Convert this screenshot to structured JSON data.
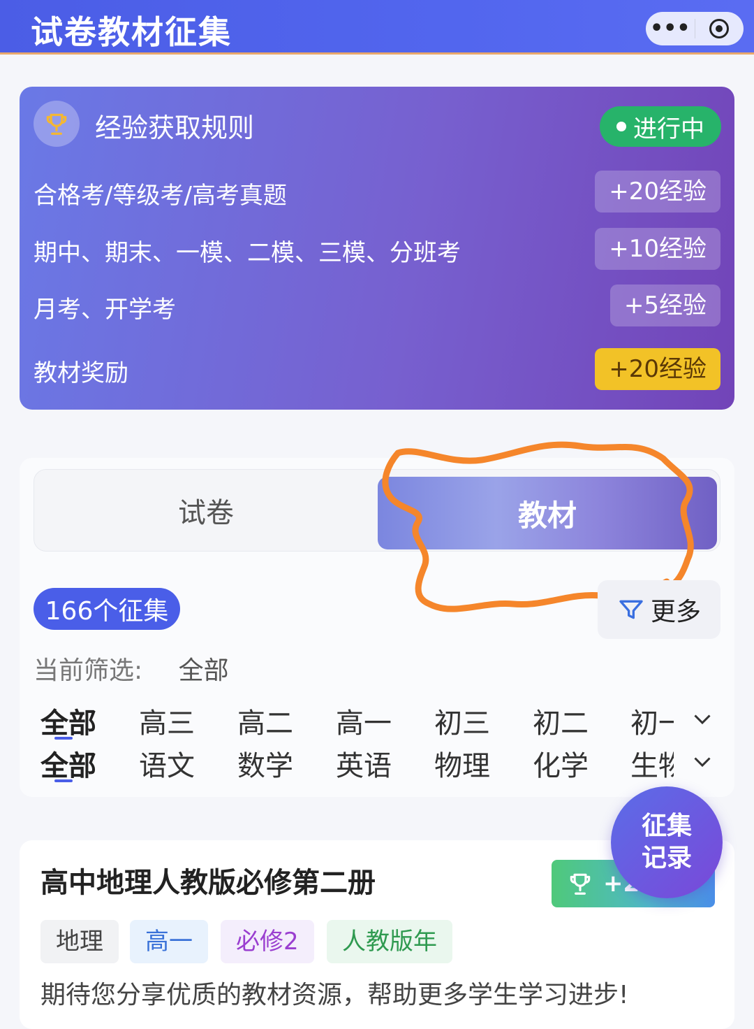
{
  "header": {
    "title": "试卷教材征集",
    "more_icon": "more-dots-icon",
    "close_icon": "target-icon"
  },
  "rules": {
    "title": "经验获取规则",
    "icon": "trophy-icon",
    "status": "进行中",
    "items": [
      {
        "label": "合格考/等级考/高考真题",
        "reward": "+20经验"
      },
      {
        "label": "期中、期末、一模、二模、三模、分班考",
        "reward": "+10经验"
      },
      {
        "label": "月考、开学考",
        "reward": "+5经验"
      },
      {
        "label": "教材奖励",
        "reward": "+20经验"
      }
    ],
    "colors": {
      "status": "#27b36a",
      "highlight_badge": "#f2c227"
    }
  },
  "tabs": [
    {
      "label": "试卷",
      "active": false
    },
    {
      "label": "教材",
      "active": true
    }
  ],
  "count_label": "166个征集",
  "more_filter": {
    "label": "更多",
    "icon": "filter-icon"
  },
  "current_filter": {
    "label": "当前筛选:",
    "value": "全部"
  },
  "grade_filters": [
    "全部",
    "高三",
    "高二",
    "高一",
    "初三",
    "初二",
    "初一"
  ],
  "subject_filters": [
    "全部",
    "语文",
    "数学",
    "英语",
    "物理",
    "化学",
    "生物"
  ],
  "fab": {
    "line1": "征集",
    "line2": "记录"
  },
  "item": {
    "title": "高中地理人教版必修第二册",
    "reward": "+2",
    "tags": {
      "subject": "地理",
      "grade": "高一",
      "module": "必修2",
      "edition": "人教版年"
    },
    "description": "期待您分享优质的教材资源，帮助更多学生学习进步!"
  },
  "accent_color": "#4a5ee8",
  "annotation_color": "#f5862b"
}
